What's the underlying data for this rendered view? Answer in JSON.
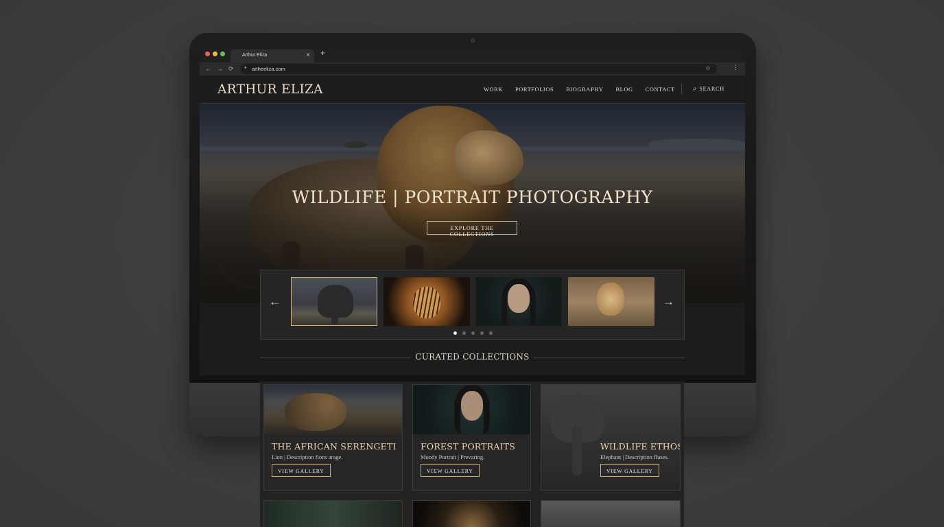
{
  "browser": {
    "tab_title": "Arthur Eliza",
    "tab_close": "×",
    "new_tab": "+",
    "url": "artheeliza.com",
    "back": "←",
    "forward": "→",
    "reload": "⟳",
    "bookmark": "☆",
    "menu": "⋮",
    "traffic_colors": [
      "#ec5f56",
      "#f2bb3c",
      "#5cc54c"
    ]
  },
  "site": {
    "logo": "ARTHUR ELIZA",
    "nav": [
      "WORK",
      "PORTFOLIOS",
      "BIOGRAPHY",
      "BLOG",
      "CONTACT"
    ],
    "search_label": "SEARCH",
    "search_icon": "⌕"
  },
  "hero": {
    "title": "WILDLIFE | PORTRAIT PHOTOGRAPHY",
    "button": "EXPLORE THE COLLECTIONS"
  },
  "carousel": {
    "prev": "←",
    "next": "→",
    "thumbs": [
      "elephant",
      "tiger",
      "woman-portrait",
      "cheetah"
    ],
    "selected_index": 0,
    "dot_count": 5,
    "active_dot": 0
  },
  "curated": {
    "heading": "CURATED COLLECTIONS"
  },
  "collections": [
    {
      "title": "THE AFRICAN SERENGETI",
      "desc": "Lion | Description fions arage.",
      "button": "VIEW GALLERY"
    },
    {
      "title": "FOREST PORTRAITS",
      "desc": "Moody Portrait | Prevaring.",
      "button": "VIEW GALLERY"
    },
    {
      "title": "WILDLIFE ETHOS",
      "desc": "Elephant | Description fluses.",
      "button": "VIEW GALLERY"
    }
  ],
  "accent_color": "#c9b890"
}
